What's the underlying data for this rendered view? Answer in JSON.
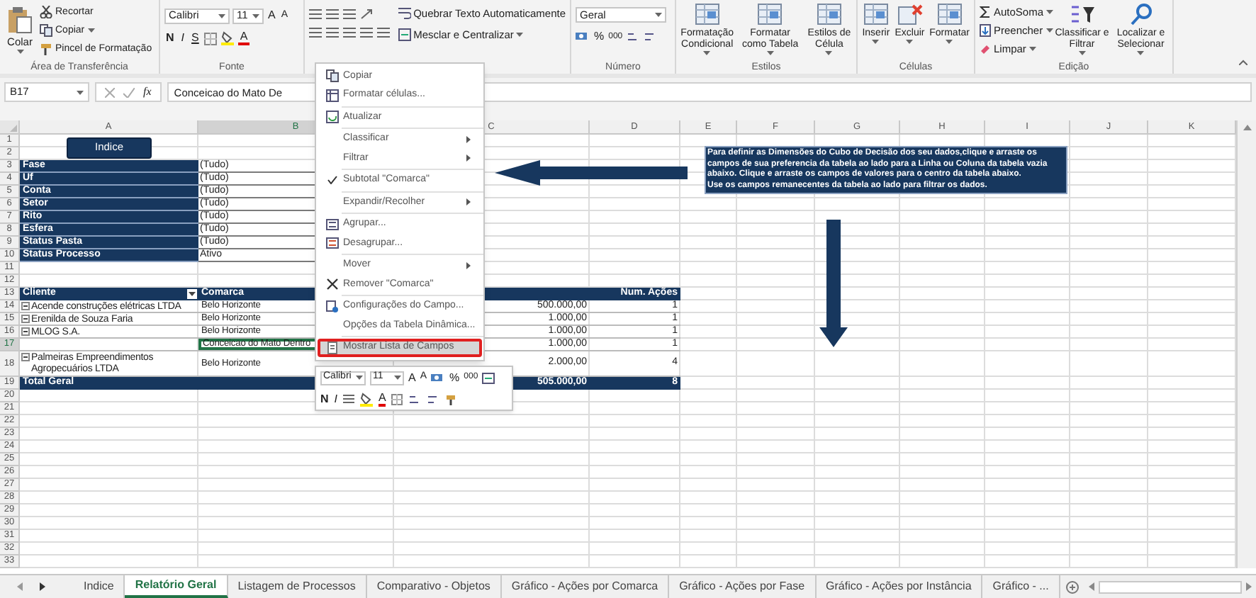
{
  "ribbon": {
    "groups": [
      {
        "label": "Área de Transferência",
        "paste": "Colar",
        "items": [
          "Recortar",
          "Copiar",
          "Pincel de Formatação"
        ]
      },
      {
        "label": "Fonte",
        "font": "Calibri",
        "size": "11",
        "grow": "A",
        "shrink": "A",
        "styles": [
          "N",
          "I",
          "S"
        ],
        "font_color": "A"
      },
      {
        "wrap": "Quebrar Texto Automaticamente",
        "merge": "Mesclar e Centralizar"
      },
      {
        "label": "Número",
        "format": "Geral",
        "percent": "%",
        "thousands": "000"
      },
      {
        "label": "Estilos",
        "buttons": [
          "Formatação Condicional",
          "Formatar como Tabela",
          "Estilos de Célula"
        ]
      },
      {
        "label": "Células",
        "buttons": [
          "Inserir",
          "Excluir",
          "Formatar"
        ]
      },
      {
        "label": "Edição",
        "items": [
          "AutoSoma",
          "Preencher",
          "Limpar"
        ],
        "buttons": [
          "Classificar e Filtrar",
          "Localizar e Selecionar"
        ]
      }
    ]
  },
  "formula_bar": {
    "name_box": "B17",
    "function_label": "fx",
    "formula": "Conceicao do Mato De"
  },
  "sheet": {
    "columns": [
      "A",
      "B",
      "C",
      "D",
      "E",
      "F",
      "G",
      "H",
      "I",
      "J",
      "K"
    ],
    "rows": [
      "1",
      "2",
      "3",
      "4",
      "5",
      "6",
      "7",
      "8",
      "9",
      "10",
      "11",
      "12",
      "13",
      "14",
      "15",
      "16",
      "17",
      "18",
      "19",
      "20",
      "21",
      "22",
      "23",
      "24",
      "25",
      "26",
      "27",
      "28",
      "29",
      "30",
      "31",
      "32",
      "33"
    ],
    "index_button": "Indice",
    "filters": [
      {
        "label": "Fase",
        "value": "(Tudo)"
      },
      {
        "label": "Uf",
        "value": "(Tudo)"
      },
      {
        "label": "Conta",
        "value": "(Tudo)"
      },
      {
        "label": "Setor",
        "value": "(Tudo)"
      },
      {
        "label": "Rito",
        "value": "(Tudo)"
      },
      {
        "label": "Esfera",
        "value": "(Tudo)"
      },
      {
        "label": "Status Pasta",
        "value": "(Tudo)"
      },
      {
        "label": "Status Processo",
        "value": "Ativo"
      }
    ],
    "pivot": {
      "headers": [
        "Cliente",
        "Comarca",
        "Num. Ações"
      ],
      "filter_button": true,
      "rows": [
        {
          "client": "Acende construções elétricas LTDA",
          "expanded": true,
          "comarca": "Belo Horizonte",
          "amount": "500.000,00",
          "count": "1",
          "selected": false
        },
        {
          "client": "Erenilda de Souza Faria",
          "expanded": true,
          "comarca": "Belo Horizonte",
          "amount": "1.000,00",
          "count": "1",
          "selected": false
        },
        {
          "client": "MLOG S.A.",
          "expanded": true,
          "comarca": "Belo Horizonte",
          "amount": "1.000,00",
          "count": "1",
          "selected": false
        },
        {
          "comarca": "Conceicao do Mato Dentro",
          "amount": "1.000,00",
          "count": "1",
          "selected": true
        },
        {
          "client": "Palmeiras Empreendimentos Agropecuários LTDA",
          "expanded": true,
          "comarca": "Belo Horizonte",
          "amount": "2.000,00",
          "count": "4",
          "selected": false
        }
      ],
      "total": {
        "label": "Total Geral",
        "amount": "505.000,00",
        "count": "8"
      }
    },
    "note": "Para definir as Dimensões do Cubo de Decisão dos seu dados,clique e arraste os campos de sua preferencia da tabela ao lado para a Linha ou Coluna da tabela vazia abaixo. Clique e arraste os campos de valores para o centro da tabela abaixo.\nUse os campos remanecentes da tabela ao lado para filtrar os dados."
  },
  "context_menu": {
    "groups": [
      [
        {
          "label": "Copiar",
          "submenu": false,
          "checked": false,
          "selected": false
        },
        {
          "label": "Formatar células...",
          "submenu": false,
          "checked": false,
          "selected": false
        }
      ],
      [
        {
          "label": "Atualizar",
          "submenu": false,
          "checked": false,
          "selected": false
        }
      ],
      [
        {
          "label": "Classificar",
          "submenu": true,
          "checked": false,
          "selected": false
        },
        {
          "label": "Filtrar",
          "submenu": true,
          "checked": false,
          "selected": false
        }
      ],
      [
        {
          "label": "Subtotal \"Comarca\"",
          "submenu": false,
          "checked": true,
          "selected": false
        }
      ],
      [
        {
          "label": "Expandir/Recolher",
          "submenu": true,
          "checked": false,
          "selected": false
        }
      ],
      [
        {
          "label": "Agrupar...",
          "submenu": false,
          "checked": false,
          "selected": false
        },
        {
          "label": "Desagrupar...",
          "submenu": false,
          "checked": false,
          "selected": false
        }
      ],
      [
        {
          "label": "Mover",
          "submenu": true,
          "checked": false,
          "selected": false
        },
        {
          "label": "Remover \"Comarca\"",
          "submenu": false,
          "checked": false,
          "selected": false
        }
      ],
      [
        {
          "label": "Configurações do Campo...",
          "submenu": false,
          "checked": false,
          "selected": false
        },
        {
          "label": "Opções da Tabela Dinâmica...",
          "submenu": false,
          "checked": false,
          "selected": false
        }
      ],
      [
        {
          "label": "Mostrar Lista de Campos",
          "submenu": false,
          "checked": false,
          "selected": true
        }
      ]
    ]
  },
  "mini_toolbar": {
    "font": "Calibri",
    "size": "11",
    "grow": "A",
    "shrink": "A",
    "percent": "%",
    "thousands": "000",
    "bold": "N",
    "italic": "I",
    "font_color": "A"
  },
  "sheet_tabs": [
    {
      "label": "Indice",
      "selected": false
    },
    {
      "label": "Relatório Geral",
      "selected": true
    },
    {
      "label": "Listagem de Processos",
      "selected": false
    },
    {
      "label": "Comparativo - Objetos",
      "selected": false
    },
    {
      "label": "Gráfico - Ações por Comarca",
      "selected": false
    },
    {
      "label": "Gráfico - Ações por Fase",
      "selected": false
    },
    {
      "label": "Gráfico - Ações por Instância",
      "selected": false
    },
    {
      "label": "Gráfico - ...",
      "selected": false
    }
  ]
}
